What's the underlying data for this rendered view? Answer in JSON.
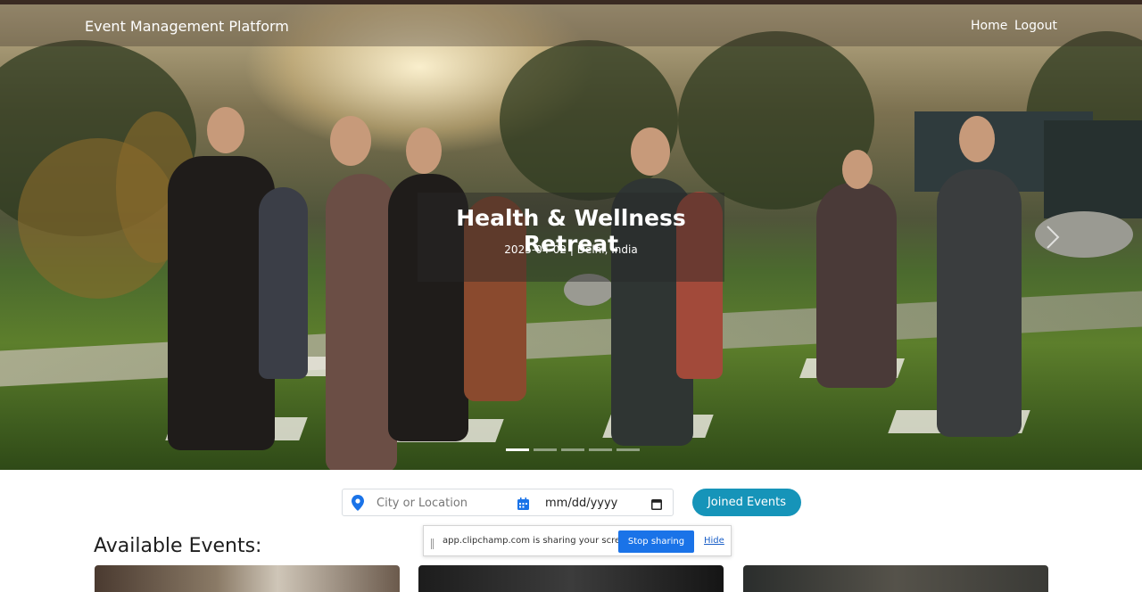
{
  "navbar": {
    "brand": "Event Management Platform",
    "links": [
      "Home",
      "Logout"
    ]
  },
  "carousel": {
    "title": "Health & Wellness Retreat",
    "subtitle": "2025-04-02 | Delhi, India",
    "slide_count": 5,
    "active_slide": 1
  },
  "search": {
    "location_placeholder": "City or Location",
    "date_placeholder": "mm/dd/yyyy"
  },
  "joined_events_label": "Joined Events",
  "section_title": "Available Events:",
  "share_notice": {
    "text": "app.clipchamp.com is sharing your screen.",
    "stop_label": "Stop sharing",
    "hide_label": "Hide"
  },
  "colors": {
    "accent": "#1694b9",
    "share_button": "#1a73e8"
  }
}
